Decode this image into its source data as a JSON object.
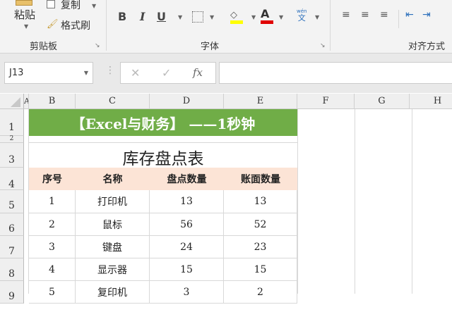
{
  "ribbon": {
    "clipboard": {
      "paste": "粘贴",
      "copy": "复制",
      "format_painter": "格式刷",
      "label": "剪贴板"
    },
    "font": {
      "bold": "B",
      "italic": "I",
      "underline": "U",
      "font_color_glyph": "A",
      "phonetic_top": "wén",
      "phonetic_bottom": "文",
      "label": "字体",
      "fill_color": "#ffff00",
      "font_color": "#e00000"
    },
    "alignment": {
      "label": "对齐方式"
    }
  },
  "formula_bar": {
    "name_box": "J13",
    "cancel": "✕",
    "enter": "✓",
    "fx": "fx",
    "formula": ""
  },
  "columns": [
    "A",
    "B",
    "C",
    "D",
    "E",
    "F",
    "G",
    "H"
  ],
  "rows": [
    "1",
    "2",
    "3",
    "4",
    "5",
    "6",
    "7",
    "8",
    "9"
  ],
  "sheet": {
    "banner": "【Excel与财务】 ——1秒钟",
    "banner_color": "#70ad47",
    "title": "库存盘点表",
    "header_color": "#fce4d6",
    "headers": [
      "序号",
      "名称",
      "盘点数量",
      "账面数量"
    ],
    "data": [
      [
        "1",
        "打印机",
        "13",
        "13"
      ],
      [
        "2",
        "鼠标",
        "56",
        "52"
      ],
      [
        "3",
        "键盘",
        "24",
        "23"
      ],
      [
        "4",
        "显示器",
        "15",
        "15"
      ],
      [
        "5",
        "复印机",
        "3",
        "2"
      ]
    ]
  }
}
